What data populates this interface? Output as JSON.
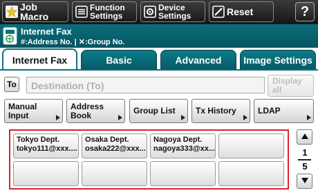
{
  "toolbar": {
    "job_macro": "Job Macro",
    "function_settings": "Function\nSettings",
    "device_settings": "Device\nSettings",
    "reset": "Reset",
    "help": "?"
  },
  "header": {
    "title": "Internet Fax",
    "subtitle": "#:Address No. | ✕:Group No."
  },
  "tabs": [
    {
      "label": "Internet Fax",
      "active": true
    },
    {
      "label": "Basic",
      "active": false
    },
    {
      "label": "Advanced",
      "active": false
    },
    {
      "label": "Image Settings",
      "active": false
    }
  ],
  "destination": {
    "to_label": "To",
    "placeholder": "Destination (To)",
    "display_all": "Display\nall"
  },
  "functions": [
    {
      "label": "Manual\nInput"
    },
    {
      "label": "Address\nBook"
    },
    {
      "label": "Group List"
    },
    {
      "label": "Tx History"
    },
    {
      "label": "LDAP"
    }
  ],
  "address_list": [
    {
      "name": "Tokyo  Dept.",
      "address": "tokyo111@xxx...."
    },
    {
      "name": "Osaka Dept.",
      "address": "osaka222@xxx..."
    },
    {
      "name": "Nagoya Dept.",
      "address": "nagoya333@xx..."
    },
    {
      "name": "",
      "address": ""
    },
    {
      "name": "",
      "address": ""
    },
    {
      "name": "",
      "address": ""
    },
    {
      "name": "",
      "address": ""
    },
    {
      "name": "",
      "address": ""
    }
  ],
  "pager": {
    "current": "1",
    "total": "5"
  },
  "colors": {
    "accent": "#0b6f7e",
    "selection_border": "#d9232d",
    "toolbar_bg": "#1e1e1e"
  },
  "icons": {
    "job_macro": "star-icon",
    "function_settings": "list-icon",
    "device_settings": "gear-icon",
    "reset": "reset-icon",
    "header": "internet-fax-icon"
  }
}
